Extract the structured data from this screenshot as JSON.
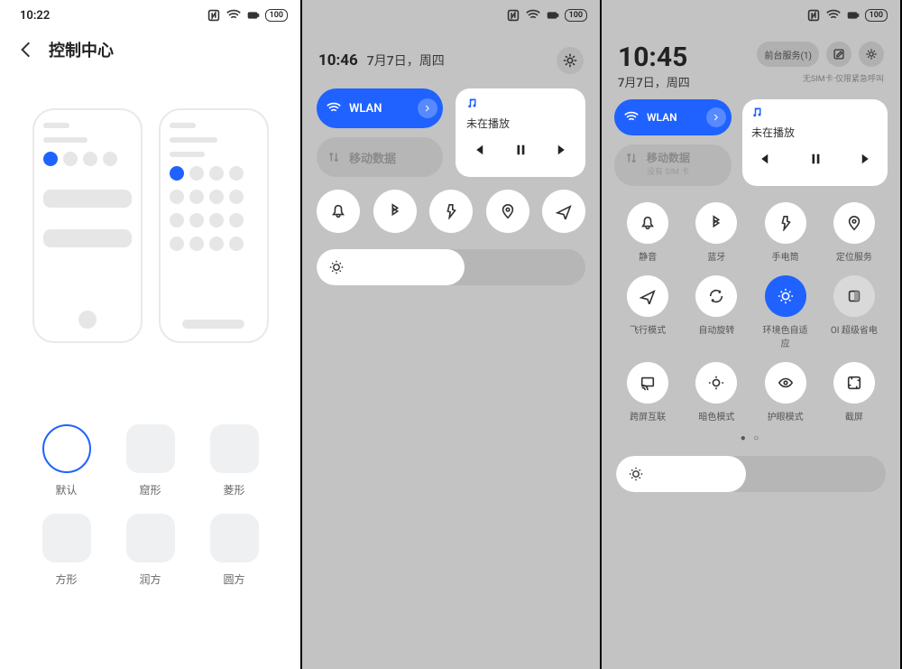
{
  "panel1": {
    "status_time": "10:22",
    "battery": "100",
    "title": "控制中心",
    "shapes": [
      {
        "label": "默认",
        "selected": true
      },
      {
        "label": "窟形",
        "selected": false
      },
      {
        "label": "菱形",
        "selected": false
      },
      {
        "label": "方形",
        "selected": false
      },
      {
        "label": "润方",
        "selected": false
      },
      {
        "label": "圆方",
        "selected": false
      }
    ]
  },
  "panel2": {
    "status_battery": "100",
    "time": "10:46",
    "date": "7月7日，周四",
    "wlan_label": "WLAN",
    "data_label": "移动数据",
    "music_status": "未在播放",
    "toggle_icons": [
      "bell",
      "bluetooth",
      "flashlight",
      "location",
      "airplane"
    ]
  },
  "panel3": {
    "status_battery": "100",
    "time": "10:45",
    "date": "7月7日，周四",
    "service_label": "前台服务(1)",
    "sim_note": "无SIM卡·仅限紧急呼叫",
    "wlan_label": "WLAN",
    "data_label": "移动数据",
    "data_sub": "没有 SIM 卡",
    "music_status": "未在播放",
    "toggles": [
      {
        "icon": "bell",
        "label": "静音"
      },
      {
        "icon": "bluetooth",
        "label": "蓝牙"
      },
      {
        "icon": "flashlight",
        "label": "手电筒"
      },
      {
        "icon": "location",
        "label": "定位服务"
      },
      {
        "icon": "airplane",
        "label": "飞行模式"
      },
      {
        "icon": "rotate",
        "label": "自动旋转"
      },
      {
        "icon": "sun",
        "label": "环境色自适应",
        "active": true
      },
      {
        "icon": "square",
        "label": "OI 超级省电",
        "dim": true
      },
      {
        "icon": "cast",
        "label": "跨屏互联"
      },
      {
        "icon": "dark",
        "label": "暗色模式"
      },
      {
        "icon": "eye",
        "label": "护眼模式"
      },
      {
        "icon": "screenshot",
        "label": "截屏"
      }
    ]
  },
  "colors": {
    "accent": "#1f62ff"
  }
}
